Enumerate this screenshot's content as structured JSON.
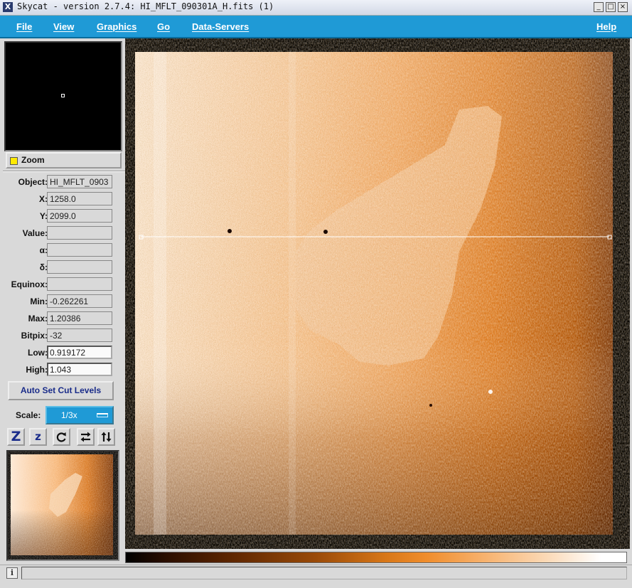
{
  "window": {
    "title": "Skycat - version 2.7.4: HI_MFLT_090301A_H.fits (1)",
    "icon": "x-window-icon",
    "buttons": {
      "minimize": "_",
      "maximize": "□",
      "close": "×"
    }
  },
  "menu": {
    "file": "File",
    "view": "View",
    "graphics": "Graphics",
    "go": "Go",
    "data_servers": "Data-Servers",
    "help": "Help"
  },
  "zoom": {
    "label": "Zoom",
    "checked": true
  },
  "fields": {
    "object": {
      "label": "Object:",
      "value": "HI_MFLT_0903"
    },
    "x": {
      "label": "X:",
      "value": "1258.0"
    },
    "y": {
      "label": "Y:",
      "value": "2099.0"
    },
    "value": {
      "label": "Value:",
      "value": ""
    },
    "alpha": {
      "label": "α:",
      "value": ""
    },
    "delta": {
      "label": "δ:",
      "value": ""
    },
    "equinox": {
      "label": "Equinox:",
      "value": ""
    },
    "min": {
      "label": "Min:",
      "value": "-0.262261"
    },
    "max": {
      "label": "Max:",
      "value": "1.20386"
    },
    "bitpix": {
      "label": "Bitpix:",
      "value": "-32"
    },
    "low": {
      "label": "Low:",
      "value": "0.919172"
    },
    "high": {
      "label": "High:",
      "value": "1.043"
    }
  },
  "cut_levels_button": "Auto Set Cut Levels",
  "scale": {
    "label": "Scale:",
    "value": "1/3x"
  },
  "toolbar": {
    "zoom_in": "Z",
    "zoom_out": "z",
    "rotate": "rotate-icon",
    "flip_x": "flip-x-icon",
    "flip_y": "flip-y-icon"
  },
  "status": {
    "icon": "i",
    "message": ""
  },
  "colors": {
    "menubar": "#1f9ad6",
    "image_mid": "#e8872c",
    "image_light": "#fbe2c8",
    "image_dark": "#8a3c06"
  }
}
